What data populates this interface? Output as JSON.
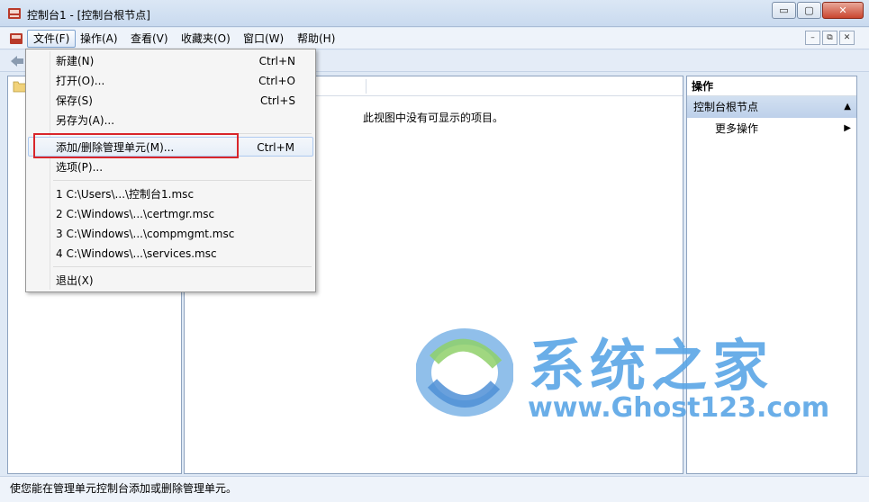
{
  "window": {
    "title": "控制台1 - [控制台根节点]",
    "min_label": "▭",
    "max_label": "▢",
    "close_label": "✕"
  },
  "menubar": {
    "items": [
      {
        "label": "文件(F)"
      },
      {
        "label": "操作(A)"
      },
      {
        "label": "查看(V)"
      },
      {
        "label": "收藏夹(O)"
      },
      {
        "label": "窗口(W)"
      },
      {
        "label": "帮助(H)"
      }
    ],
    "mdi_min": "–",
    "mdi_restore": "⧉",
    "mdi_close": "✕"
  },
  "file_menu": {
    "items": [
      {
        "label": "新建(N)",
        "shortcut": "Ctrl+N"
      },
      {
        "label": "打开(O)...",
        "shortcut": "Ctrl+O"
      },
      {
        "label": "保存(S)",
        "shortcut": "Ctrl+S"
      },
      {
        "label": "另存为(A)...",
        "shortcut": ""
      },
      {
        "label": "添加/删除管理单元(M)...",
        "shortcut": "Ctrl+M"
      },
      {
        "label": "选项(P)...",
        "shortcut": ""
      },
      {
        "label": "1 C:\\Users\\...\\控制台1.msc",
        "shortcut": ""
      },
      {
        "label": "2 C:\\Windows\\...\\certmgr.msc",
        "shortcut": ""
      },
      {
        "label": "3 C:\\Windows\\...\\compmgmt.msc",
        "shortcut": ""
      },
      {
        "label": "4 C:\\Windows\\...\\services.msc",
        "shortcut": ""
      },
      {
        "label": "退出(X)",
        "shortcut": ""
      }
    ]
  },
  "center": {
    "empty_message": "此视图中没有可显示的项目。"
  },
  "actions_pane": {
    "header": "操作",
    "section": "控制台根节点",
    "section_toggle": "▲",
    "more_actions": "更多操作",
    "more_arrow": "▶"
  },
  "statusbar": {
    "text": "使您能在管理单元控制台添加或删除管理单元。"
  },
  "watermark": {
    "title": "系统之家",
    "url": "www.Ghost123.com"
  },
  "colors": {
    "accent": "#5aa6e6",
    "highlight_border": "#d9262b"
  }
}
